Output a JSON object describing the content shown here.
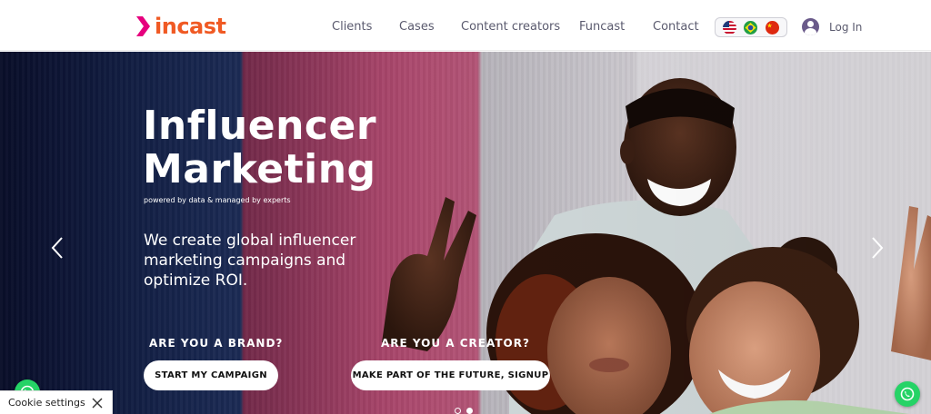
{
  "brand": {
    "logo_text": "incast",
    "accent": "#f05a24",
    "chevron_color": "#e6007e"
  },
  "nav": {
    "items": [
      {
        "label": "Clients"
      },
      {
        "label": "Cases"
      },
      {
        "label": "Content creators"
      },
      {
        "label": "Funcast"
      },
      {
        "label": "Contact"
      }
    ],
    "languages": [
      {
        "icon": "us-flag-icon"
      },
      {
        "icon": "brazil-flag-icon"
      },
      {
        "icon": "china-flag-icon"
      }
    ],
    "login_label": "Log In"
  },
  "hero": {
    "headline_line1": "Influencer",
    "headline_line2": "Marketing",
    "tagline": "powered by data & managed by experts",
    "lede": "We create global influencer marketing campaigns and optimize ROI.",
    "brand_question": "ARE YOU A BRAND?",
    "brand_button": "START MY CAMPAIGN",
    "creator_question": "ARE YOU A CREATOR?",
    "creator_button": "MAKE PART OF THE FUTURE, SIGNUP",
    "slide_count": 2,
    "active_slide": 2
  },
  "cookie": {
    "label": "Cookie settings"
  },
  "whatsapp_color": "#25d366"
}
